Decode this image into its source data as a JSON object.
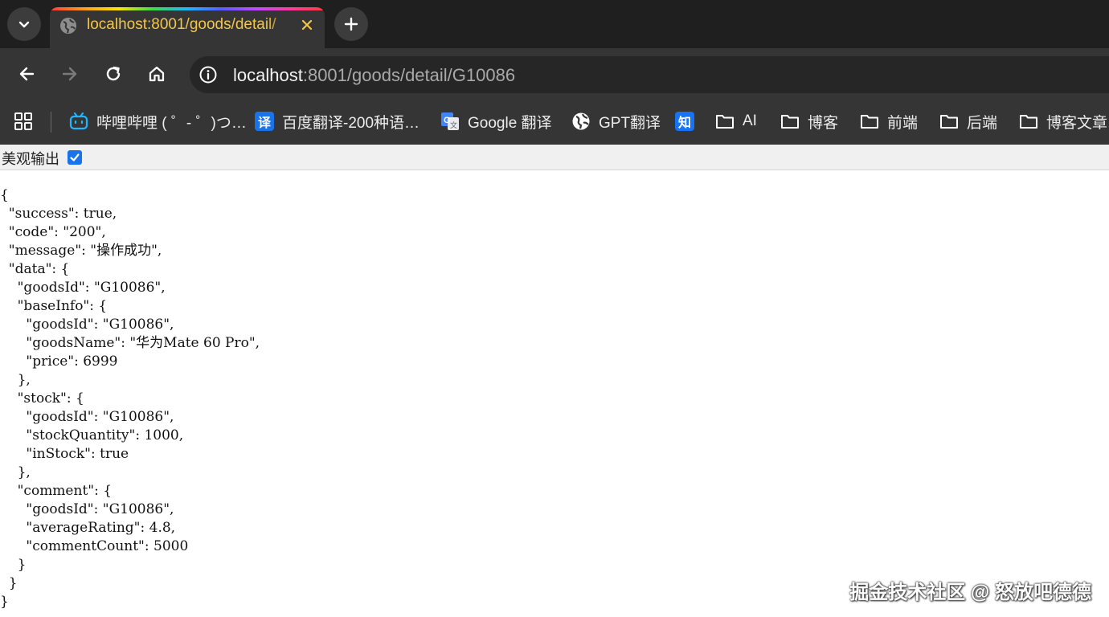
{
  "tab": {
    "title": "localhost:8001/goods/detail/"
  },
  "omnibox": {
    "host": "localhost",
    "rest": ":8001/goods/detail/G10086"
  },
  "bookmarks": [
    {
      "label": "哔哩哔哩 ( ゜- ゜)つ…",
      "icon": "bilibili-icon"
    },
    {
      "label": "百度翻译-200种语…",
      "icon": "baidu-translate-icon",
      "badge": "译"
    },
    {
      "label": "Google 翻译",
      "icon": "google-translate-icon"
    },
    {
      "label": "GPT翻译",
      "icon": "globe-icon"
    },
    {
      "label": "",
      "icon": "zhihu-icon",
      "badge": "知"
    },
    {
      "label": "AI",
      "icon": "folder-icon"
    },
    {
      "label": "博客",
      "icon": "folder-icon"
    },
    {
      "label": "前端",
      "icon": "folder-icon"
    },
    {
      "label": "后端",
      "icon": "folder-icon"
    },
    {
      "label": "博客文章",
      "icon": "folder-icon"
    }
  ],
  "page": {
    "pretty_label": "美观输出",
    "pretty_checked": true,
    "json_lines": [
      "{",
      "  \"success\": true,",
      "  \"code\": \"200\",",
      "  \"message\": \"操作成功\",",
      "  \"data\": {",
      "    \"goodsId\": \"G10086\",",
      "    \"baseInfo\": {",
      "      \"goodsId\": \"G10086\",",
      "      \"goodsName\": \"华为Mate 60 Pro\",",
      "      \"price\": 6999",
      "    },",
      "    \"stock\": {",
      "      \"goodsId\": \"G10086\",",
      "      \"stockQuantity\": 1000,",
      "      \"inStock\": true",
      "    },",
      "    \"comment\": {",
      "      \"goodsId\": \"G10086\",",
      "      \"averageRating\": 4.8,",
      "      \"commentCount\": 5000",
      "    }",
      "  }",
      "}"
    ],
    "watermark": "掘金技术社区 @ 怒放吧德德"
  }
}
